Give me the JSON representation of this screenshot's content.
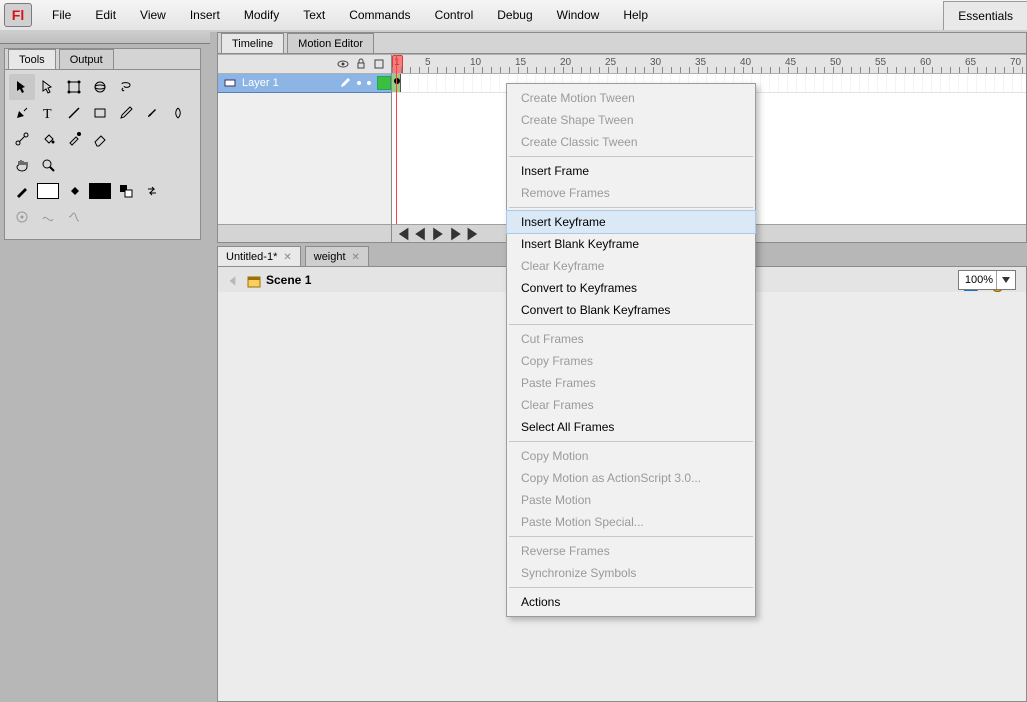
{
  "app": {
    "badge": "Fl",
    "workspace": "Essentials"
  },
  "menu": {
    "items": [
      "File",
      "Edit",
      "View",
      "Insert",
      "Modify",
      "Text",
      "Commands",
      "Control",
      "Debug",
      "Window",
      "Help"
    ]
  },
  "tools_panel": {
    "tabs": [
      "Tools",
      "Output"
    ]
  },
  "timeline": {
    "tabs": [
      "Timeline",
      "Motion Editor"
    ],
    "layer_name": "Layer 1",
    "ruler_start": 1,
    "ruler_step": 5,
    "ruler_count": 15
  },
  "doc_tabs": [
    {
      "label": "Untitled-1*"
    },
    {
      "label": "weight"
    }
  ],
  "editbar": {
    "scene": "Scene 1",
    "zoom": "100%"
  },
  "context": {
    "groups": [
      [
        {
          "t": "Create Motion Tween",
          "d": true
        },
        {
          "t": "Create Shape Tween",
          "d": true
        },
        {
          "t": "Create Classic Tween",
          "d": true
        }
      ],
      [
        {
          "t": "Insert Frame",
          "d": false
        },
        {
          "t": "Remove Frames",
          "d": true
        }
      ],
      [
        {
          "t": "Insert Keyframe",
          "d": false,
          "hl": true
        },
        {
          "t": "Insert Blank Keyframe",
          "d": false
        },
        {
          "t": "Clear Keyframe",
          "d": true
        },
        {
          "t": "Convert to Keyframes",
          "d": false
        },
        {
          "t": "Convert to Blank Keyframes",
          "d": false
        }
      ],
      [
        {
          "t": "Cut Frames",
          "d": true
        },
        {
          "t": "Copy Frames",
          "d": true
        },
        {
          "t": "Paste Frames",
          "d": true
        },
        {
          "t": "Clear Frames",
          "d": true
        },
        {
          "t": "Select All Frames",
          "d": false
        }
      ],
      [
        {
          "t": "Copy Motion",
          "d": true
        },
        {
          "t": "Copy Motion as ActionScript 3.0...",
          "d": true
        },
        {
          "t": "Paste Motion",
          "d": true
        },
        {
          "t": "Paste Motion Special...",
          "d": true
        }
      ],
      [
        {
          "t": "Reverse Frames",
          "d": true
        },
        {
          "t": "Synchronize Symbols",
          "d": true
        }
      ],
      [
        {
          "t": "Actions",
          "d": false
        }
      ]
    ]
  }
}
